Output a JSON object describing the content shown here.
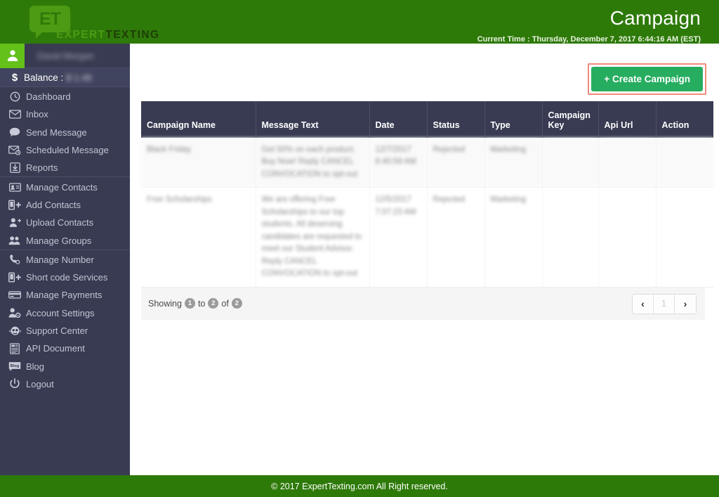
{
  "header": {
    "logo_primary": "EXPERT",
    "logo_secondary": "TEXTING",
    "logo_mark": "ET",
    "title": "Campaign",
    "current_time": "Current Time : Thursday, December 7, 2017 6:44:16 AM (EST)",
    "brand_green": "#2e7a09",
    "logo_green": "#4d9b14"
  },
  "sidebar": {
    "background": "#383b52",
    "user": {
      "name": "David Morgan",
      "avatar_icon": "user-icon"
    },
    "balance": {
      "icon": "$",
      "label": "Balance :",
      "value": "$ 1.48"
    },
    "groups": [
      {
        "divided": false,
        "items": [
          {
            "label": "Dashboard",
            "icon": "dashboard-icon"
          },
          {
            "label": "Inbox",
            "icon": "envelope-icon"
          },
          {
            "label": "Send Message",
            "icon": "chat-bubble-icon"
          },
          {
            "label": "Scheduled Message",
            "icon": "scheduled-envelope-icon"
          },
          {
            "label": "Reports",
            "icon": "download-box-icon"
          }
        ]
      },
      {
        "divided": true,
        "items": [
          {
            "label": "Manage Contacts",
            "icon": "contact-card-icon"
          },
          {
            "label": "Add Contacts",
            "icon": "add-phone-icon"
          },
          {
            "label": "Upload Contacts",
            "icon": "user-plus-icon"
          },
          {
            "label": "Manage Groups",
            "icon": "users-group-icon"
          }
        ]
      },
      {
        "divided": true,
        "items": [
          {
            "label": "Manage Number",
            "icon": "phone-icon"
          },
          {
            "label": "Short code Services",
            "icon": "add-phone-icon"
          },
          {
            "label": "Manage Payments",
            "icon": "credit-card-icon"
          },
          {
            "label": "Account Settings",
            "icon": "user-gear-icon"
          },
          {
            "label": "Support Center",
            "icon": "support-headset-icon"
          },
          {
            "label": "API Document",
            "icon": "document-icon"
          },
          {
            "label": "Blog",
            "icon": "blog-icon"
          },
          {
            "label": "Logout",
            "icon": "power-icon"
          }
        ]
      }
    ]
  },
  "toolbar": {
    "create_campaign_label": "+ Create Campaign",
    "create_button_color": "#27ad60",
    "highlight_color": "#f08b7d"
  },
  "table": {
    "columns": [
      "Campaign Name",
      "Message Text",
      "Date",
      "Status",
      "Type",
      "Campaign Key",
      "Api Url",
      "Action"
    ],
    "rows": [
      {
        "campaign_name": "Black Friday",
        "message_text": "Get 50% on each product. Buy Now! Reply CANCEL CONVOCATION to opt-out",
        "date": "12/7/2017 6:40:59 AM",
        "status": "Rejected",
        "type": "Marketing",
        "campaign_key": "",
        "api_url": "",
        "action": ""
      },
      {
        "campaign_name": "Free Scholarships",
        "message_text": "We are offering Free Scholarships to our top students. All deserving candidates are requested to meet our Student Advisor. Reply CANCEL CONVOCATION to opt-out",
        "date": "12/5/2017 7:07:23 AM",
        "status": "Rejected",
        "type": "Marketing",
        "campaign_key": "",
        "api_url": "",
        "action": ""
      }
    ]
  },
  "pagination": {
    "showing_prefix": "Showing",
    "from": "1",
    "to_word": "to",
    "to": "2",
    "of_word": "of",
    "total": "2",
    "prev_label": "‹",
    "page_label": "1",
    "next_label": "›"
  },
  "footer": {
    "text": "© 2017 ExpertTexting.com All Right reserved."
  }
}
